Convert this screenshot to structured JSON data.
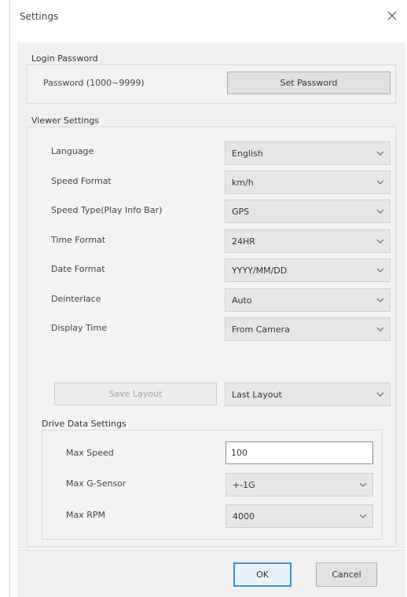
{
  "window": {
    "title": "Settings"
  },
  "login_password": {
    "section_title": "Login Password",
    "password_label": "Password (1000~9999)",
    "set_button": "Set Password"
  },
  "viewer_settings": {
    "section_title": "Viewer Settings",
    "rows": [
      {
        "label": "Language",
        "value": "English"
      },
      {
        "label": "Speed Format",
        "value": "km/h"
      },
      {
        "label": "Speed Type(Play Info Bar)",
        "value": "GPS"
      },
      {
        "label": "Time Format",
        "value": "24HR"
      },
      {
        "label": "Date Format",
        "value": "YYYY/MM/DD"
      },
      {
        "label": "Deinterlace",
        "value": "Auto"
      },
      {
        "label": "Display Time",
        "value": "From Camera"
      }
    ],
    "save_layout_button": "Save Layout",
    "layout_value": "Last Layout"
  },
  "drive_data": {
    "section_title": "Drive Data Settings",
    "max_speed_label": "Max Speed",
    "max_speed_value": "100",
    "max_gsensor_label": "Max G-Sensor",
    "max_gsensor_value": "+-1G",
    "max_rpm_label": "Max RPM",
    "max_rpm_value": "4000"
  },
  "footer": {
    "ok": "OK",
    "cancel": "Cancel"
  },
  "icons": {
    "close": "close-icon",
    "dropdown": "chevron-down-icon"
  }
}
